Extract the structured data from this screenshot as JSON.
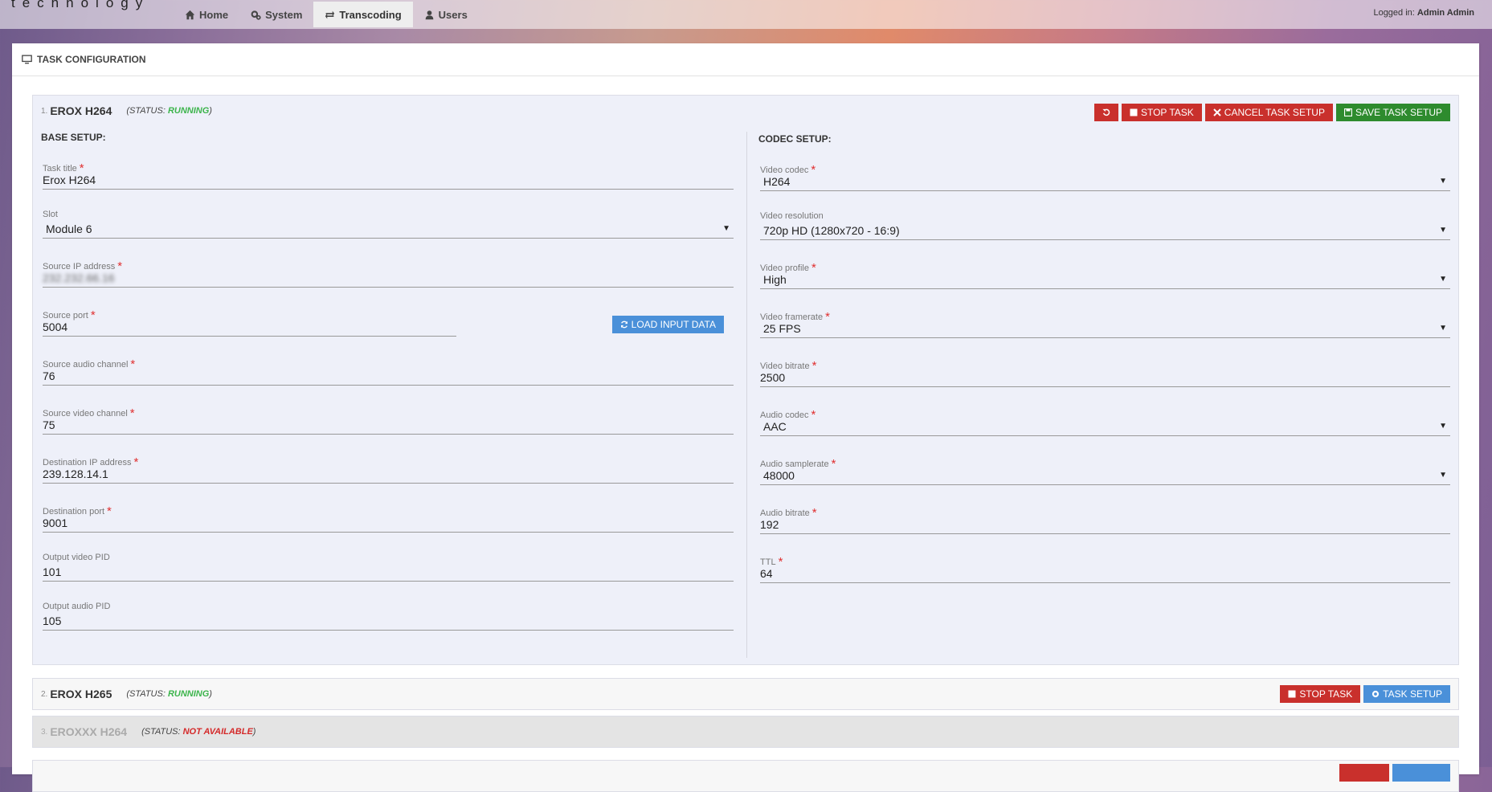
{
  "brand": "technology",
  "nav": {
    "items": [
      {
        "label": "Home",
        "icon": "home-icon"
      },
      {
        "label": "System",
        "icon": "cogs-icon"
      },
      {
        "label": "Transcoding",
        "icon": "exchange-icon"
      },
      {
        "label": "Users",
        "icon": "user-icon"
      }
    ],
    "active": "Transcoding"
  },
  "login": {
    "prefix": "Logged in:",
    "user": "Admin Admin"
  },
  "panel_title": "TASK CONFIGURATION",
  "tasks": [
    {
      "num": "1.",
      "name": "EROX H264",
      "status_prefix": "(STATUS:",
      "status": "RUNNING",
      "status_suffix": ")"
    },
    {
      "num": "2.",
      "name": "EROX H265",
      "status_prefix": "(STATUS:",
      "status": "RUNNING",
      "status_suffix": ")"
    },
    {
      "num": "3.",
      "name": "EROXXX H264",
      "status_prefix": "(STATUS:",
      "status": "NOT AVAILABLE",
      "status_suffix": ")"
    }
  ],
  "task1_actions": {
    "stop": "STOP TASK",
    "cancel": "CANCEL TASK SETUP",
    "save": "SAVE TASK SETUP"
  },
  "task2_actions": {
    "stop": "STOP TASK",
    "setup": "TASK SETUP"
  },
  "base_setup": {
    "title": "BASE SETUP:",
    "fields": [
      {
        "label": "Task title",
        "value": "Erox H264"
      },
      {
        "label": "Slot",
        "value": "Module 6"
      },
      {
        "label": "Source IP address",
        "value": "232.232.66.16"
      },
      {
        "label": "Source port",
        "value": "5004"
      },
      {
        "label": "Source audio channel",
        "value": "76"
      },
      {
        "label": "Source video channel",
        "value": "75"
      },
      {
        "label": "Destination IP address",
        "value": "239.128.14.1"
      },
      {
        "label": "Destination port",
        "value": "9001"
      },
      {
        "label": "Output video PID",
        "value": "101"
      },
      {
        "label": "Output audio PID",
        "value": "105"
      }
    ],
    "load_button": "LOAD INPUT DATA"
  },
  "codec_setup": {
    "title": "CODEC SETUP:",
    "fields": [
      {
        "label": "Video codec",
        "value": "H264"
      },
      {
        "label": "Video resolution",
        "value": "720p HD (1280x720 - 16:9)"
      },
      {
        "label": "Video profile",
        "value": "High"
      },
      {
        "label": "Video framerate",
        "value": "25 FPS"
      },
      {
        "label": "Video bitrate",
        "value": "2500"
      },
      {
        "label": "Audio codec",
        "value": "AAC"
      },
      {
        "label": "Audio samplerate",
        "value": "48000"
      },
      {
        "label": "Audio bitrate",
        "value": "192"
      },
      {
        "label": "TTL",
        "value": "64"
      }
    ]
  },
  "required_mark": "*",
  "caret": "▼",
  "colors": {
    "running": "#3cb44b",
    "not_available": "#d42a2a",
    "danger": "#c9302c",
    "success": "#2e8b2e",
    "info": "#4a90d9"
  }
}
